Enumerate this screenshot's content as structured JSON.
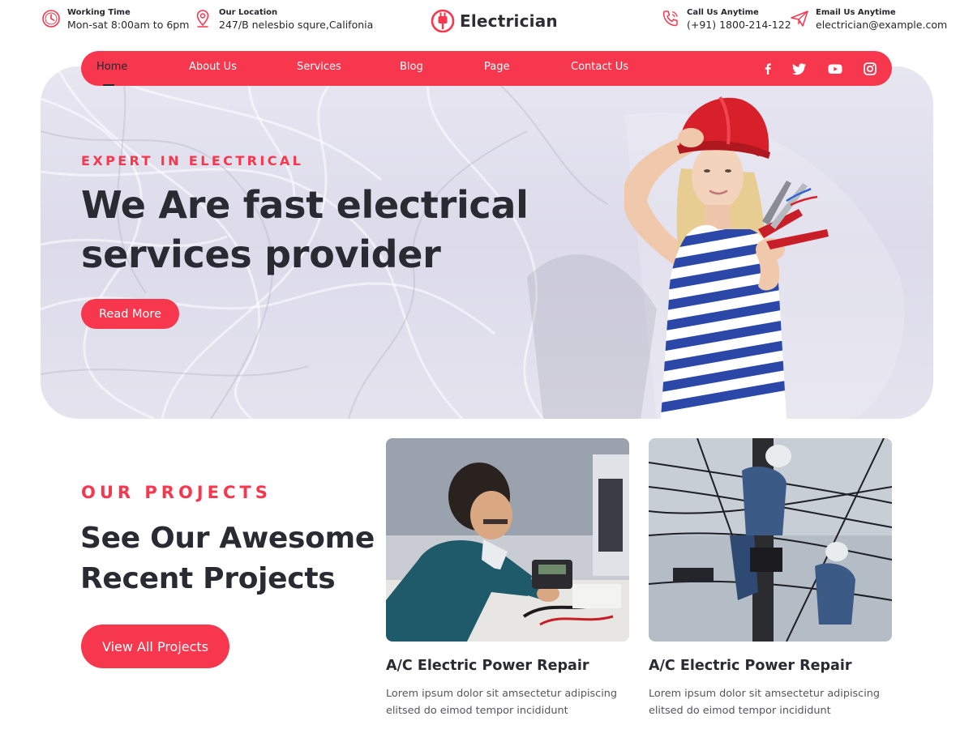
{
  "topbar": {
    "working": {
      "label": "Working Time",
      "value": "Mon-sat 8:00am to 6pm",
      "icon": "clock-icon"
    },
    "location": {
      "label": "Our Location",
      "value": "247/B nelesbio squre,Califonia",
      "icon": "map-pin-icon"
    },
    "brand": {
      "name": "Electrician",
      "icon": "plug-logo-icon"
    },
    "phone": {
      "label": "Call Us Anytime",
      "value": "(+91) 1800-214-122",
      "icon": "phone-icon"
    },
    "email": {
      "label": "Email Us Anytime",
      "value": "electrician@example.com",
      "icon": "paper-plane-icon"
    }
  },
  "nav": {
    "items": [
      {
        "label": "Home",
        "active": true
      },
      {
        "label": "About Us"
      },
      {
        "label": "Services"
      },
      {
        "label": "Blog"
      },
      {
        "label": "Page"
      },
      {
        "label": "Contact Us"
      }
    ],
    "social": [
      "facebook-icon",
      "twitter-icon",
      "youtube-icon",
      "instagram-icon"
    ]
  },
  "hero": {
    "eyebrow": "EXPERT IN ELECTRICAL",
    "title": "We Are fast electrical services provider",
    "button": "Read More"
  },
  "projects": {
    "eyebrow": "OUR PROJECTS",
    "title": "See Our Awesome Recent Projects",
    "button": "View All Projects",
    "cards": [
      {
        "title": "A/C Electric Power Repair",
        "desc": "Lorem ipsum dolor sit amsectetur adipiscing elitsed do eimod tempor incididunt"
      },
      {
        "title": "A/C Electric Power Repair",
        "desc": "Lorem ipsum dolor sit amsectetur adipiscing elitsed do eimod tempor incididunt"
      }
    ]
  },
  "colors": {
    "accent": "#f7374d",
    "heading": "#2a2a33",
    "hero_bg": "#e2e1ed"
  }
}
